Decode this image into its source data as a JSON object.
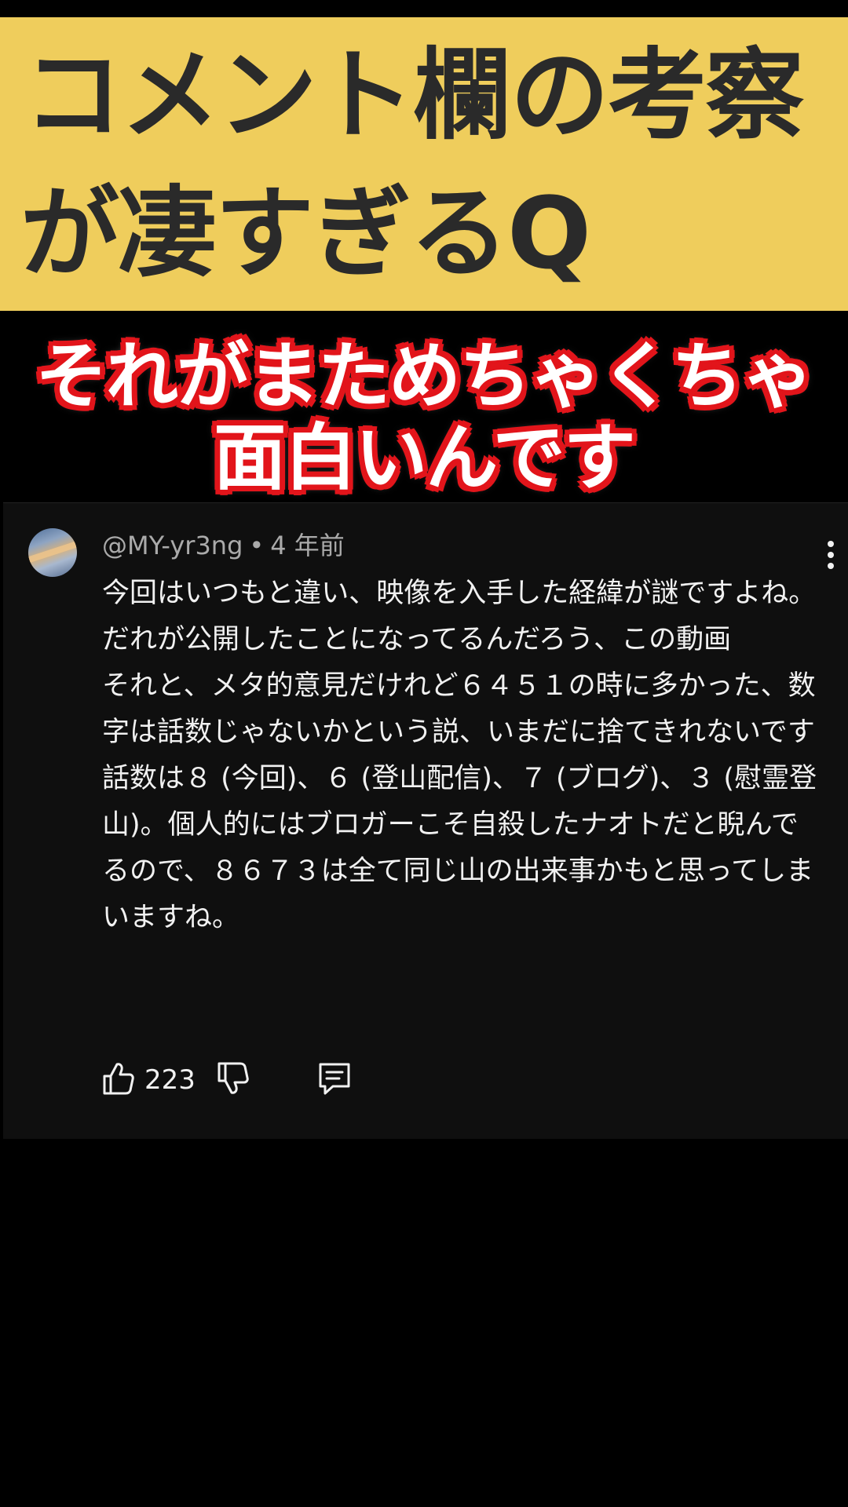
{
  "banner": {
    "title_line1": "コメント欄の考察",
    "title_line2": "が凄すぎるQ"
  },
  "caption": {
    "line1": "それがまためちゃくちゃ",
    "line2": "面白いんです"
  },
  "comment": {
    "author": "@MY-yr3ng",
    "separator": "•",
    "time": "4 年前",
    "paragraphs": [
      "今回はいつもと違い、映像を入手した経緯が謎ですよね。だれが公開したことになってるんだろう、この動画",
      "それと、メタ的意見だけれど６４５１の時に多かった、数字は話数じゃないかという説、いまだに捨てきれないです",
      "話数は８ (今回)、６ (登山配信)、７ (ブログ)、３ (慰霊登山)。個人的にはブロガーこそ自殺したナオトだと睨んでるので、８６７３は全て同じ山の出来事かもと思ってしまいますね。"
    ],
    "like_count": "223",
    "icons": {
      "like": "thumbs-up-icon",
      "dislike": "thumbs-down-icon",
      "reply": "reply-comment-icon",
      "more": "more-vertical-icon"
    }
  },
  "colors": {
    "banner_bg": "#efcd5c",
    "banner_text": "#2a2a2a",
    "caption_outline": "#e2151b",
    "card_bg": "#0f0f0f",
    "meta_text": "#aaaaaa",
    "body_text": "#f1f1f1"
  }
}
